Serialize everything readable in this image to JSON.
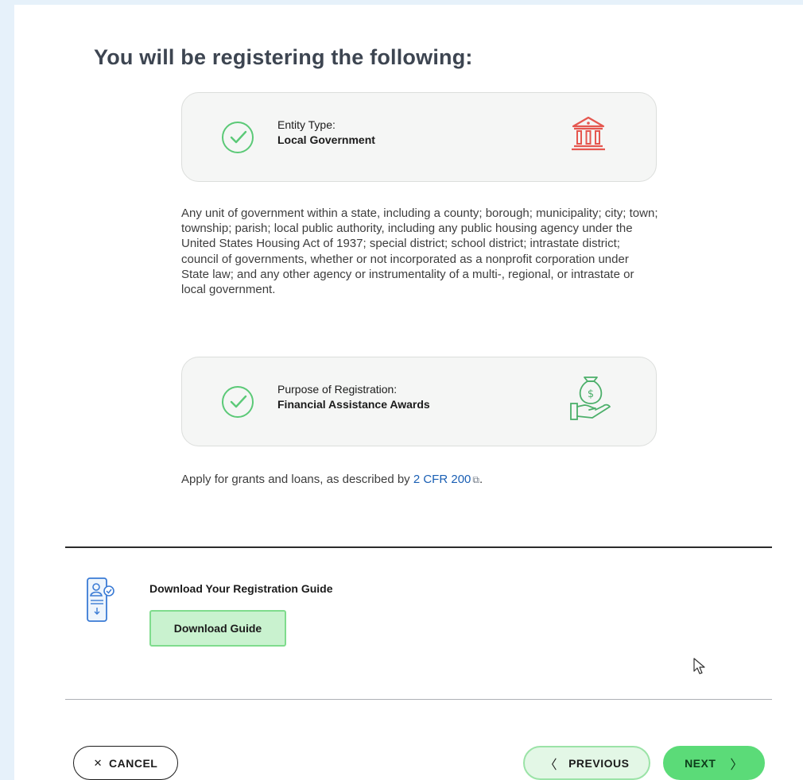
{
  "page": {
    "heading": "You will be registering the following:"
  },
  "entity_card": {
    "label": "Entity Type:",
    "value": "Local Government",
    "icon": "government-building-icon",
    "icon_color": "#e5574f"
  },
  "entity_description": "Any unit of government within a state, including a county; borough; municipality; city; town; township; parish; local public authority, including any public housing agency under the United States Housing Act of 1937; special district; school district; intrastate district; council of governments, whether or not incorporated as a nonprofit corporation under State law; and any other agency or instrumentality of a multi-, regional, or intrastate or local government.",
  "purpose_card": {
    "label": "Purpose of Registration:",
    "value": "Financial Assistance Awards",
    "icon": "money-bag-hand-icon",
    "icon_color": "#4caf6a"
  },
  "purpose_description": {
    "prefix": "Apply for grants and loans, as described by ",
    "link_text": "2 CFR 200",
    "suffix": "."
  },
  "guide": {
    "title": "Download Your Registration Guide",
    "button_label": "Download Guide"
  },
  "footer": {
    "cancel_label": "CANCEL",
    "previous_label": "PREVIOUS",
    "next_label": "NEXT"
  },
  "colors": {
    "check_green": "#5bc977",
    "link_blue": "#1a5fb4",
    "next_green": "#5bdb78",
    "heading_gray": "#3d4551"
  }
}
